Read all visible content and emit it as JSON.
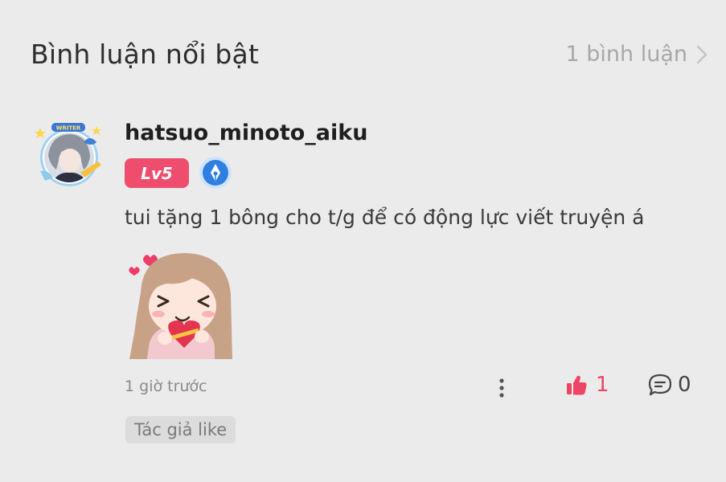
{
  "header": {
    "title": "Bình luận nổi bật",
    "count_link": "1 bình luận"
  },
  "comment": {
    "username": "hatsuo_minoto_aiku",
    "level": "Lv5",
    "avatar_frame_label": "WRITER",
    "text": "tui tặng 1 bông cho t/g để có động lực viết truyện á",
    "time": "1 giờ trước",
    "likes": "1",
    "replies": "0",
    "tag": "Tác giả like"
  },
  "colors": {
    "background": "#ebebeb",
    "accent_pink": "#ef4d6e",
    "like_red": "#ee4466",
    "badge_blue": "#2f7fe0"
  }
}
